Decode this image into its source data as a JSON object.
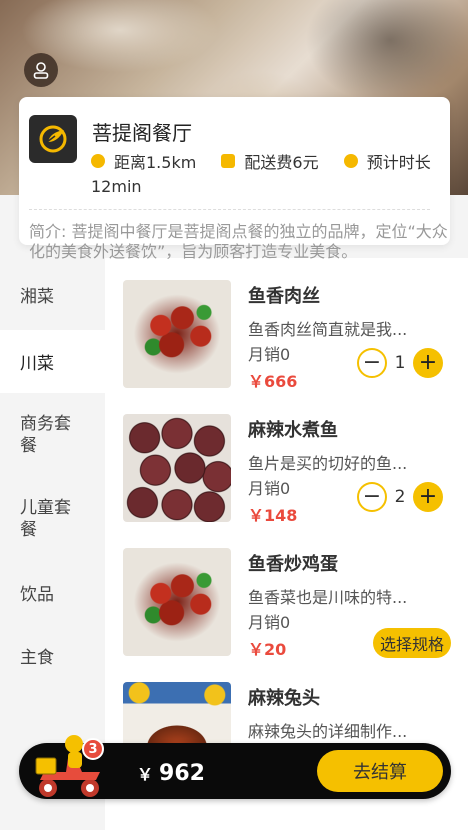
{
  "shop": {
    "name": "菩提阁餐厅",
    "distance": "距离1.5km",
    "delivery_fee": "配送费6元",
    "eta_label": "预计时长",
    "eta_value": "12min",
    "intro": "简介: 菩提阁中餐厅是菩提阁点餐的独立的品牌，定位“大众 化的美食外送餐饮”，旨为顾客打造专业美食。"
  },
  "sidebar": {
    "items": [
      {
        "label": "湘菜"
      },
      {
        "label": "川菜",
        "active": true
      },
      {
        "label": "商务套餐"
      },
      {
        "label": "儿童套餐"
      },
      {
        "label": "饮品"
      },
      {
        "label": "主食"
      }
    ]
  },
  "dishes": [
    {
      "name": "鱼香肉丝",
      "desc": "鱼香肉丝简直就是我...",
      "sales": "月销0",
      "price": "￥666",
      "qty": "1",
      "minus": "−",
      "plus": "+"
    },
    {
      "name": "麻辣水煮鱼",
      "desc": "鱼片是买的切好的鱼...",
      "sales": "月销0",
      "price": "￥148",
      "qty": "2",
      "minus": "−",
      "plus": "+"
    },
    {
      "name": "鱼香炒鸡蛋",
      "desc": "鱼香菜也是川味的特...",
      "sales": "月销0",
      "price": "￥20",
      "spec": "选择规格"
    },
    {
      "name": "麻辣兔头",
      "desc": "麻辣兔头的详细制作..."
    }
  ],
  "cart": {
    "badge": "3",
    "currency": "￥",
    "total": "962",
    "checkout_label": "去结算"
  },
  "colors": {
    "accent": "#f5c000",
    "price": "#ea4a3d",
    "cart_bg": "#0a0a0a"
  },
  "icons": [
    "user-icon",
    "shop-logo-icon",
    "clock-icon",
    "bag-icon",
    "navigation-icon",
    "courier-scooter-icon"
  ]
}
